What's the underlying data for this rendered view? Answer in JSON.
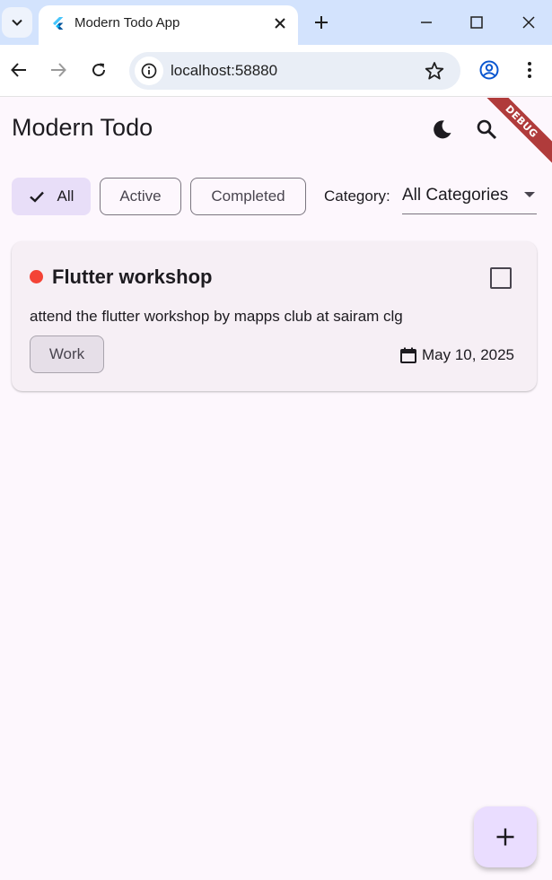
{
  "browser": {
    "tab_title": "Modern Todo App",
    "url": "localhost:58880"
  },
  "app": {
    "title": "Modern Todo",
    "debug_label": "DEBUG",
    "filters": [
      {
        "label": "All",
        "selected": true
      },
      {
        "label": "Active",
        "selected": false
      },
      {
        "label": "Completed",
        "selected": false
      }
    ],
    "category": {
      "label": "Category:",
      "value": "All Categories"
    },
    "todos": [
      {
        "title": "Flutter workshop",
        "description": "attend the flutter workshop by mapps club at sairam clg",
        "tag": "Work",
        "date": "May 10, 2025",
        "priority_color": "#f44336",
        "completed": false
      }
    ]
  },
  "colors": {
    "accent": "#eaddff",
    "background": "#fdf7fd"
  }
}
